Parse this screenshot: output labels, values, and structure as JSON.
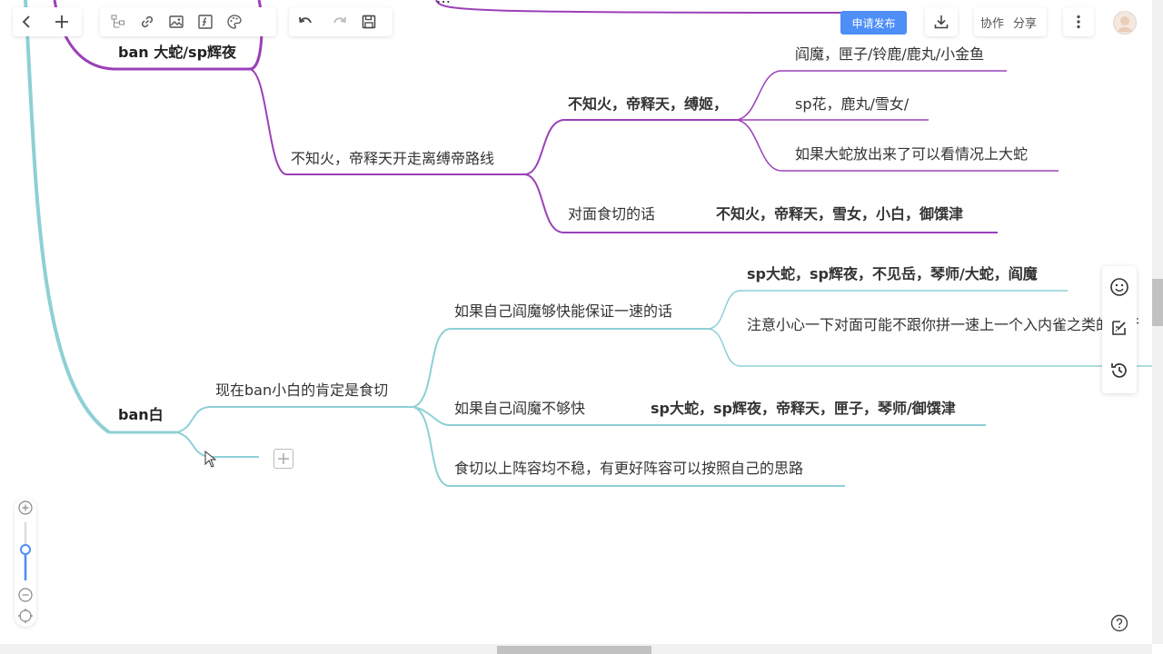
{
  "toolbar": {
    "publish_label": "申请发布",
    "collab_label": "协作",
    "share_label": "分享"
  },
  "mindmap": {
    "top_partial": "…",
    "branch1": {
      "root": "ban 大蛇/sp辉夜",
      "child": "不知火，帝释天开走离缚帝路线",
      "sub1": "不知火，帝释天，缚姬，",
      "sub1_items": [
        "阎魔，匣子/铃鹿/鹿丸/小金鱼",
        "sp花，鹿丸/雪女/",
        "如果大蛇放出来了可以看情况上大蛇"
      ],
      "sub2": "对面食切的话",
      "sub2_item": "不知火，帝释天，雪女，小白，御馔津"
    },
    "branch2": {
      "root": "ban白",
      "child": "现在ban小白的肯定是食切",
      "sub1": "如果自己阎魔够快能保证一速的话",
      "sub1_items": [
        "sp大蛇，sp辉夜，不见岳，琴师/大蛇，阎魔",
        "注意小心一下对面可能不跟你拼一速上一个入内雀之类的也行"
      ],
      "sub2": "如果自己阎魔不够快",
      "sub2_item": "sp大蛇，sp辉夜，帝释天，匣子，琴师/御馔津",
      "sub3": "食切以上阵容均不稳，有更好阵容可以按照自己的思路"
    }
  },
  "colors": {
    "purple": "#9b40b8",
    "teal": "#8dd0d6",
    "accent": "#4d8ef7"
  },
  "zoom_level": 0.5
}
